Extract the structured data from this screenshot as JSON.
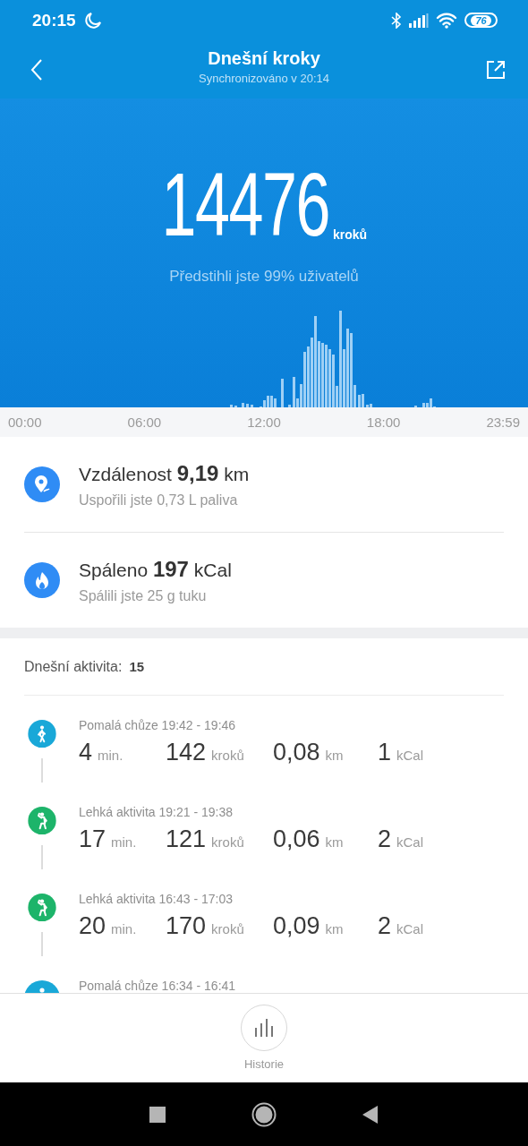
{
  "status_bar": {
    "time": "20:15",
    "battery": "76"
  },
  "header": {
    "title": "Dnešní kroky",
    "subtitle": "Synchronizováno v 20:14"
  },
  "steps": {
    "value": "14476",
    "unit": "kroků",
    "comparison": "Předstihli jste 99% uživatelů"
  },
  "timeline_labels": [
    "00:00",
    "06:00",
    "12:00",
    "18:00",
    "23:59"
  ],
  "summary": [
    {
      "kind": "distance",
      "label": "Vzdálenost **9,19** km",
      "note": "Uspořili jste 0,73 L paliva"
    },
    {
      "kind": "calories",
      "label": "Spáleno **197** kCal",
      "note": "Spálili jste 25 g tuku"
    }
  ],
  "activity": {
    "label": "Dnešní aktivita:",
    "count": "15",
    "items": [
      {
        "kind": "walk",
        "color": "#19a8d8",
        "title": "Pomalá chůze 19:42 - 19:46",
        "stats": [
          {
            "value": "4",
            "unit": "min."
          },
          {
            "value": "142",
            "unit": "kroků"
          },
          {
            "value": "0,08",
            "unit": "km"
          },
          {
            "value": "1",
            "unit": "kCal"
          }
        ]
      },
      {
        "kind": "light",
        "color": "#1db46a",
        "title": "Lehká aktivita 19:21 - 19:38",
        "stats": [
          {
            "value": "17",
            "unit": "min."
          },
          {
            "value": "121",
            "unit": "kroků"
          },
          {
            "value": "0,06",
            "unit": "km"
          },
          {
            "value": "2",
            "unit": "kCal"
          }
        ]
      },
      {
        "kind": "light",
        "color": "#1db46a",
        "title": "Lehká aktivita 16:43 - 17:03",
        "stats": [
          {
            "value": "20",
            "unit": "min."
          },
          {
            "value": "170",
            "unit": "kroků"
          },
          {
            "value": "0,09",
            "unit": "km"
          },
          {
            "value": "2",
            "unit": "kCal"
          }
        ]
      },
      {
        "kind": "walk",
        "color": "#19a8d8",
        "title": "Pomalá chůze 16:34 - 16:41"
      }
    ]
  },
  "bottom_nav": {
    "label": "Historie"
  }
}
